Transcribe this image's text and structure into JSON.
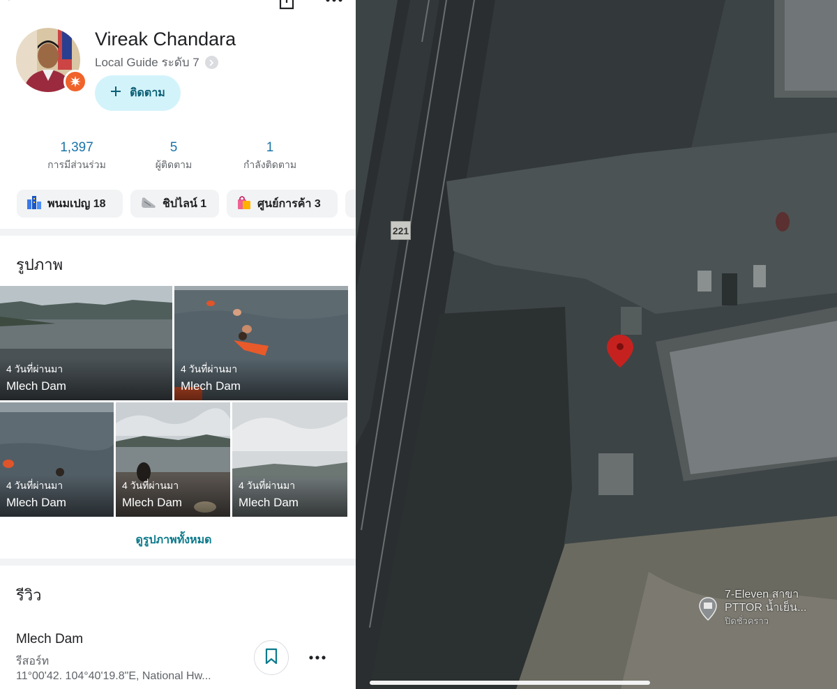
{
  "profile": {
    "name": "Vireak Chandara",
    "level": "Local Guide ระดับ 7",
    "follow_label": "ติดตาม"
  },
  "stats": [
    {
      "value": "1,397",
      "label": "การมีส่วนร่วม"
    },
    {
      "value": "5",
      "label": "ผู้ติดตาม"
    },
    {
      "value": "1",
      "label": "กำลังติดตาม"
    }
  ],
  "chips": [
    {
      "label": "พนมเปญ 18",
      "icon": "city-icon"
    },
    {
      "label": "ชิปไลน์ 1",
      "icon": "shoe-icon"
    },
    {
      "label": "ศูนย์การค้า 3",
      "icon": "shopping-bag-icon"
    }
  ],
  "photos": {
    "title": "รูปภาพ",
    "items": [
      {
        "time": "4 วันที่ผ่านมา",
        "place": "Mlech Dam"
      },
      {
        "time": "4 วันที่ผ่านมา",
        "place": "Mlech Dam"
      },
      {
        "time": "4 วันที่ผ่านมา",
        "place": "Mlech Dam"
      },
      {
        "time": "4 วันที่ผ่านมา",
        "place": "Mlech Dam"
      },
      {
        "time": "4 วันที่ผ่านมา",
        "place": "Mlech Dam"
      }
    ],
    "view_all": "ดูรูปภาพทั้งหมด"
  },
  "reviews": {
    "title": "รีวิว",
    "item": {
      "place": "Mlech Dam",
      "type": "รีสอร์ท",
      "address": "11°00'42. 104°40'19.8\"E, National Hw..."
    }
  },
  "map": {
    "route_number": "221",
    "poi_name_1": "7-Eleven สาขา",
    "poi_name_2": "PTTOR น้ำเย็น...",
    "poi_status": "ปิดชั่วคราว",
    "pin_color": "#c5221f"
  },
  "colors": {
    "accent": "#1a73a8",
    "follow_bg": "#d3f3fb",
    "badge": "#f0632a"
  }
}
